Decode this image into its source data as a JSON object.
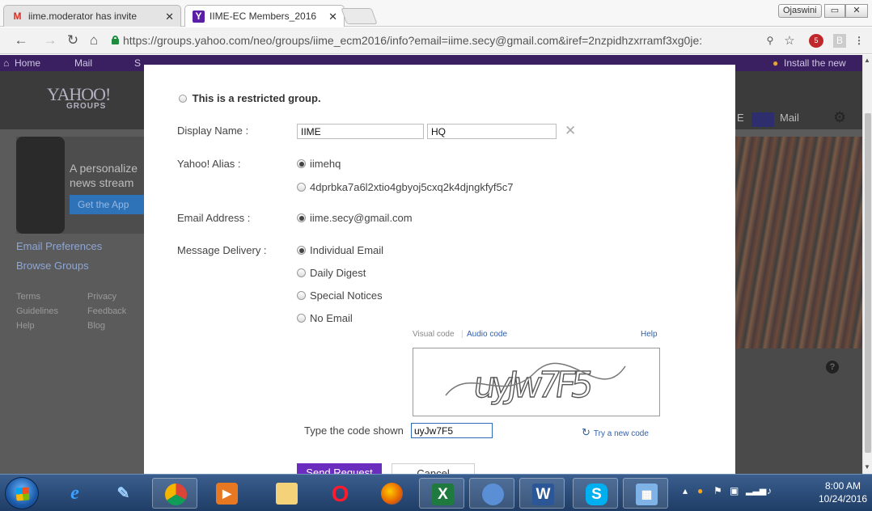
{
  "browser": {
    "tabs": [
      {
        "favicon": "M",
        "title": "iime.moderator has invite",
        "close": "✕"
      },
      {
        "favicon": "Y",
        "title": "IIME-EC Members_2016",
        "close": "✕"
      }
    ],
    "user_chip": "Ojaswini",
    "url": "https://groups.yahoo.com/neo/groups/iime_ecm2016/info?email=iime.secy@gmail.com&iref=2nzpidhzxrramf3xg0je:",
    "extensions": {
      "abp_badge": "5",
      "b_label": "B",
      "menu": "⋮"
    }
  },
  "yahoo": {
    "nav": {
      "home": "Home",
      "mail": "Mail",
      "s": "S",
      "install": "Install the new"
    },
    "logo": "YAHOO!",
    "logo_sub": "GROUPS",
    "header_letter": "E",
    "mail_label": "Mail",
    "promo_text_1": "A personalize",
    "promo_text_2": "news stream",
    "promo_button": "Get the App",
    "links": {
      "email_prefs": "Email Preferences",
      "browse": "Browse Groups"
    },
    "footer": [
      [
        "Terms",
        "Privacy"
      ],
      [
        "Guidelines",
        "Feedback"
      ],
      [
        "Help",
        "Blog"
      ]
    ]
  },
  "modal": {
    "title": "This is a restricted group.",
    "display_name_label": "Display Name :",
    "first_name": "IIME",
    "last_name": "HQ",
    "alias_label": "Yahoo! Alias :",
    "alias_options": [
      "iimehq",
      "4dprbka7a6l2xtio4gbyoj5cxq2k4djngkfyf5c7"
    ],
    "email_label": "Email Address :",
    "email_value": "iime.secy@gmail.com",
    "delivery_label": "Message Delivery :",
    "delivery_options": [
      "Individual Email",
      "Daily Digest",
      "Special Notices",
      "No Email"
    ],
    "captcha": {
      "visual_code": "Visual code",
      "audio_code": "Audio code",
      "help": "Help",
      "image_text": "uyJw7F5",
      "type_label": "Type the code shown",
      "typed_value": "uyJw7F5",
      "try_new": "Try a new code"
    },
    "send_button": "Send Request",
    "cancel_button": "Cancel"
  },
  "taskbar": {
    "time": "8:00 AM",
    "date": "10/24/2016"
  }
}
